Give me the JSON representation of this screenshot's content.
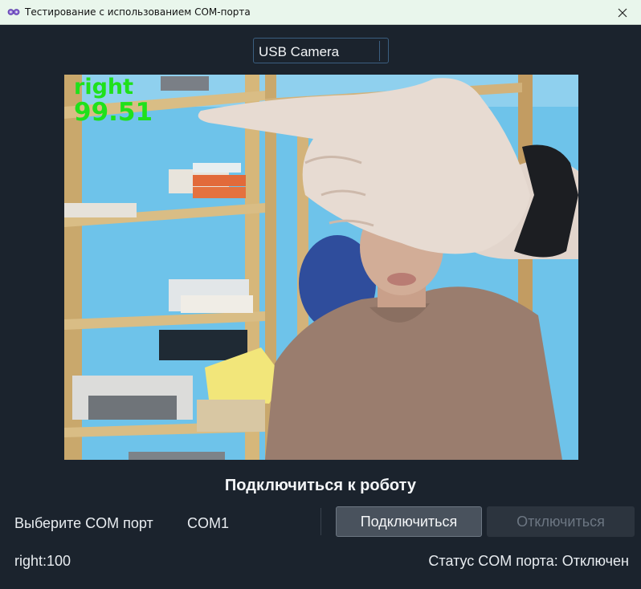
{
  "window": {
    "title": "Тестирование с использованием COM-порта",
    "app_icon": "infinity-glasses-icon",
    "close_icon": "close-icon"
  },
  "camera_select": {
    "selected": "USB Camera"
  },
  "video": {
    "detected_class": "right",
    "confidence": "99.51",
    "overlay_color": "#1fe11b"
  },
  "connection": {
    "heading": "Подключиться к роботу",
    "com_label": "Выберите COM порт",
    "com_port": "COM1",
    "connect_label": "Подключиться",
    "disconnect_label": "Отключиться"
  },
  "status": {
    "gesture": "right:100",
    "com_status": "Статус COM порта: Отключен"
  },
  "colors": {
    "background": "#1b232d",
    "titlebar": "#e9f6ec",
    "accent_border": "#3b5f80"
  }
}
